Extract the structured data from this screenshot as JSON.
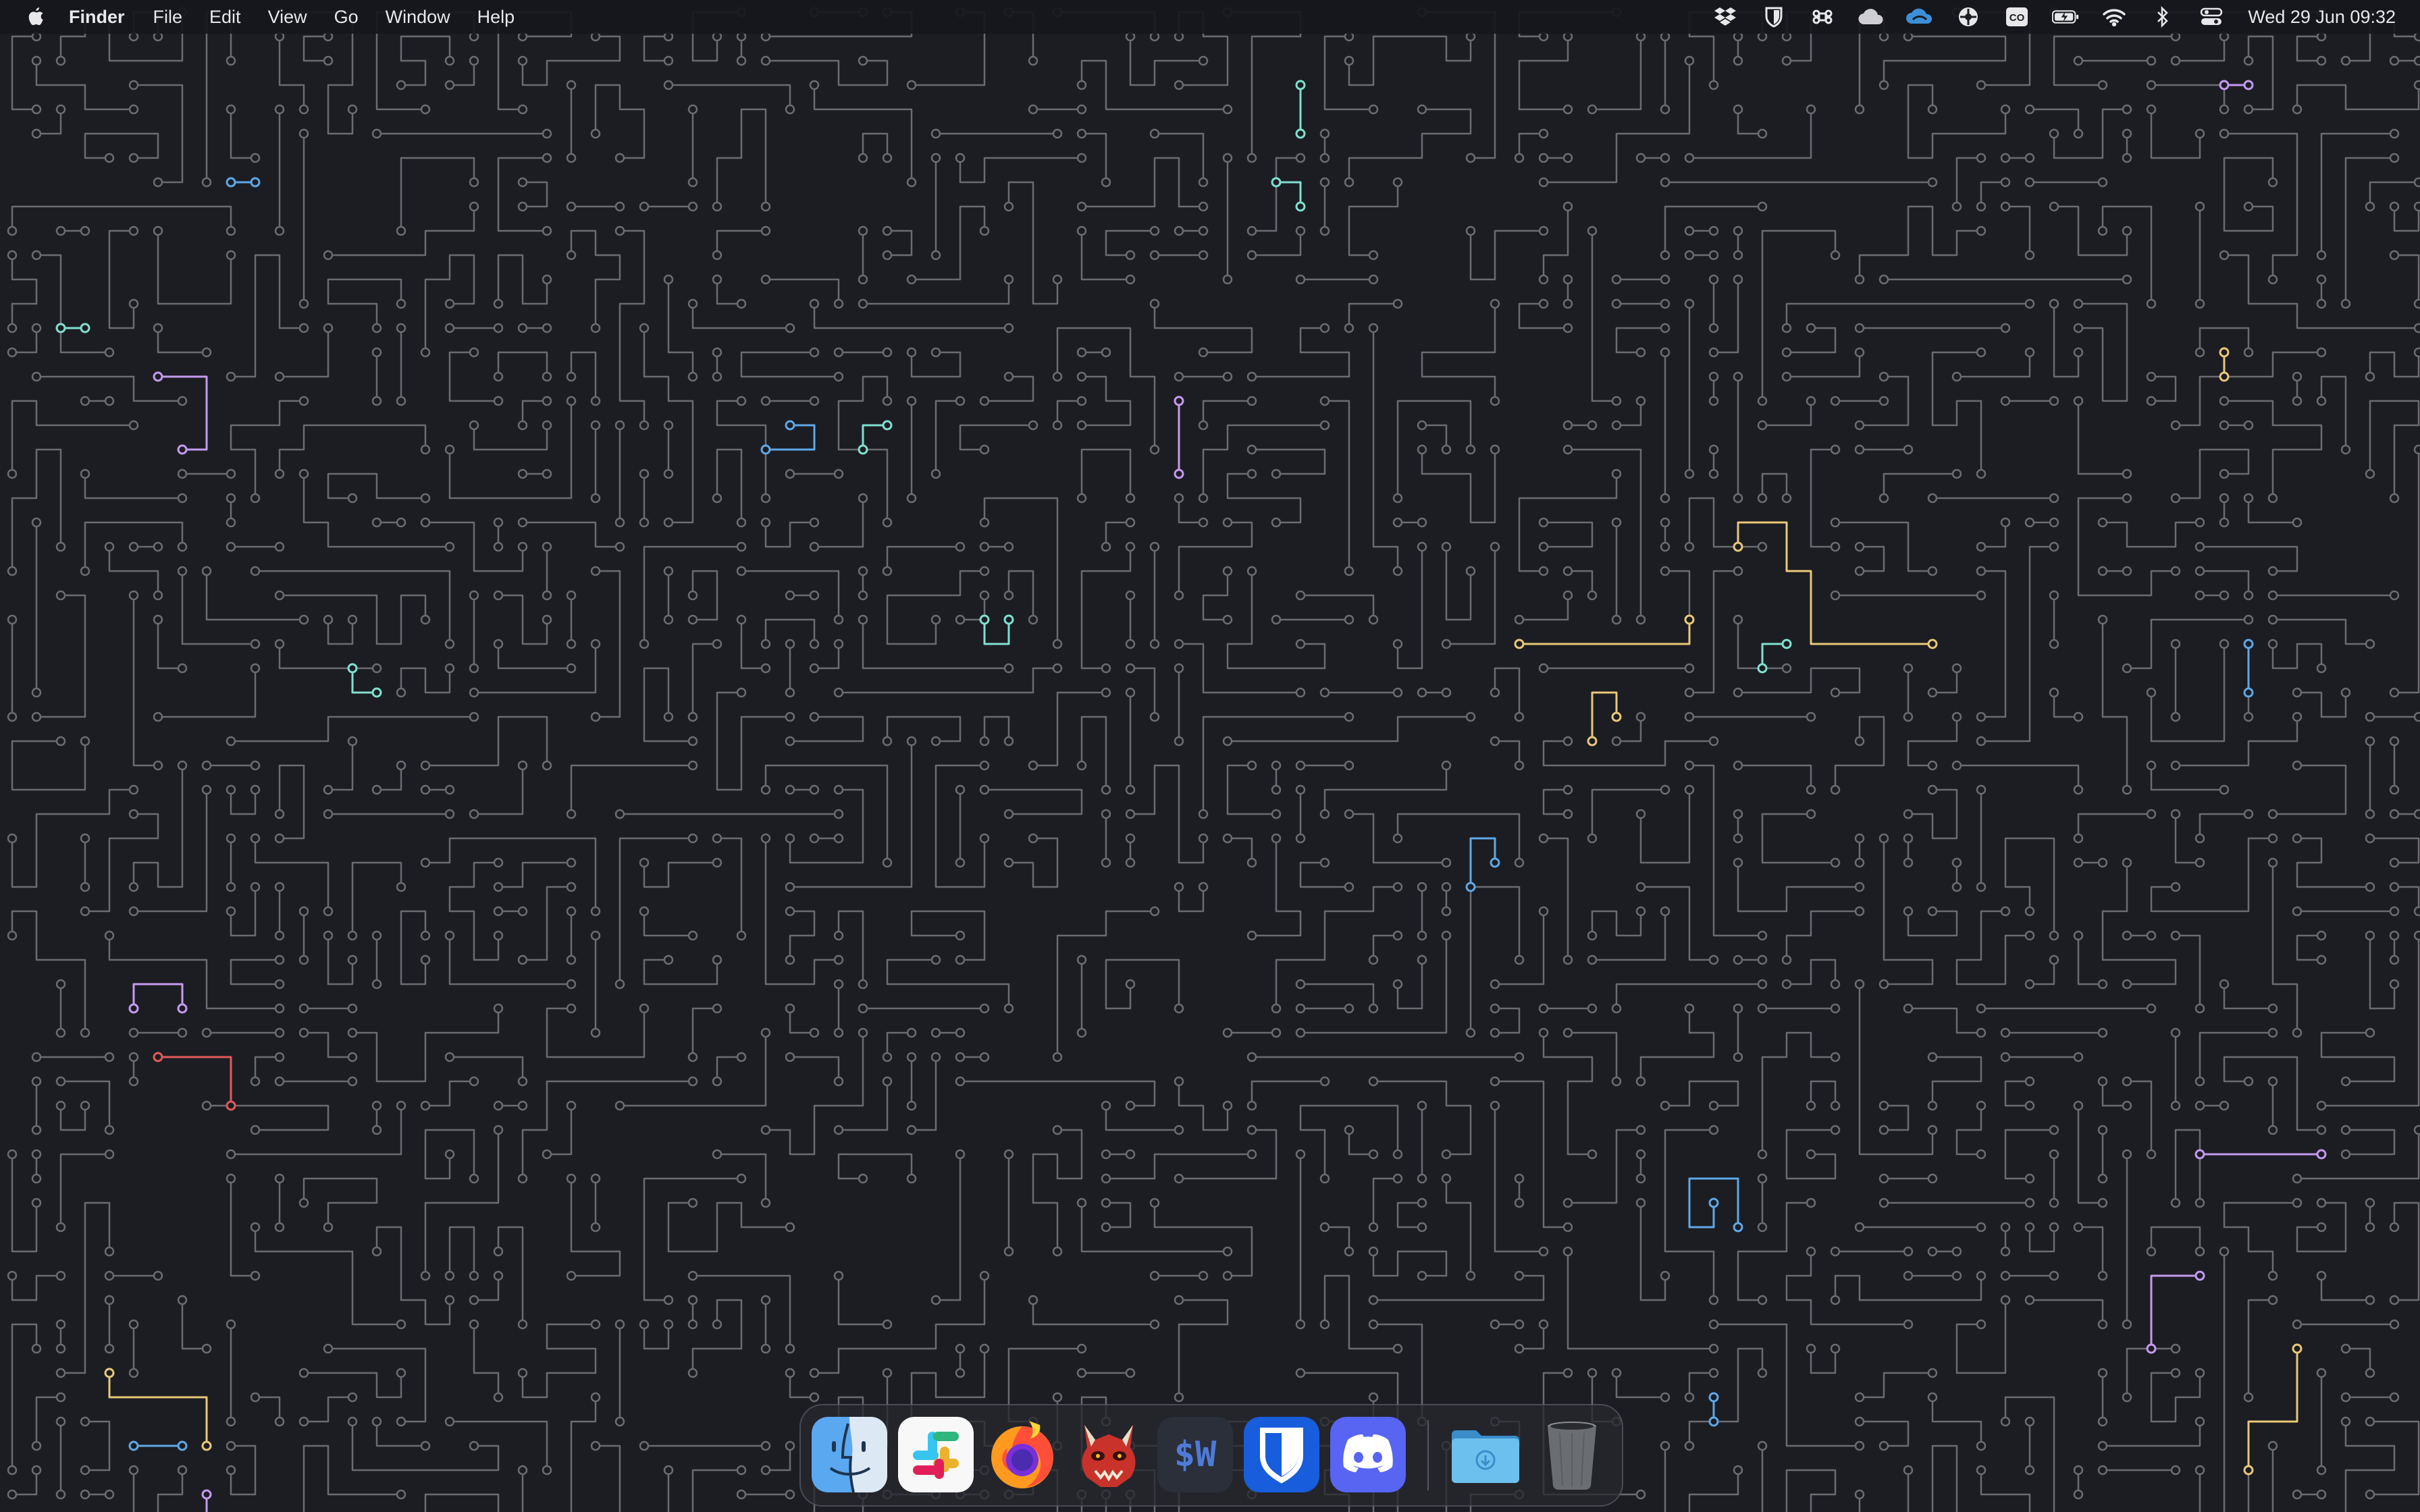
{
  "menubar": {
    "app_name": "Finder",
    "menus": [
      "File",
      "Edit",
      "View",
      "Go",
      "Window",
      "Help"
    ],
    "status_icons": [
      "dropbox-icon",
      "shield-icon",
      "command-icon",
      "cloud-icon",
      "cloud-sync-icon",
      "mosaic-icon",
      "cc-icon",
      "battery-charging-icon",
      "wifi-icon",
      "bluetooth-icon",
      "control-center-icon"
    ],
    "clock": "Wed 29 Jun  09:32"
  },
  "dock": {
    "apps": [
      "finder-icon",
      "slack-icon",
      "firefox-icon",
      "doom-icon",
      "warp-icon",
      "bitwarden-icon",
      "discord-icon"
    ],
    "warp_label": "$W",
    "folders": [
      "downloads-folder-icon",
      "trash-icon"
    ]
  },
  "colors": {
    "background": "#1c1d22",
    "maze_line": "#6a6c72",
    "accents": [
      "#e8c878",
      "#7fe0d0",
      "#5ea8e8",
      "#c49af0",
      "#e05a5a"
    ]
  }
}
